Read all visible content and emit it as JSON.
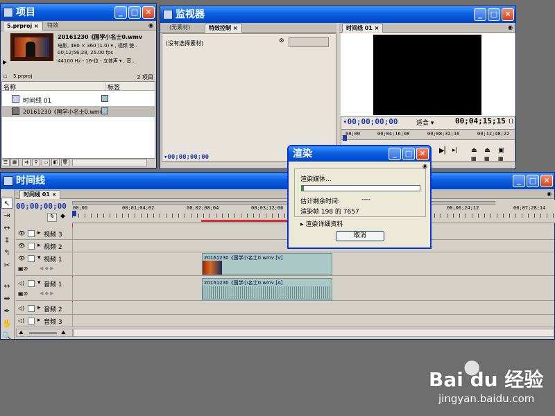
{
  "project": {
    "title": "项目",
    "tabs": [
      "5.prproj",
      "特效"
    ],
    "clip_name": "20161230《国学小名士0.wmv",
    "clip_info1": "电影, 480 × 360 (1.0) ▾ , 视频 使..",
    "clip_info2": "00;12;56;28, 25.00 fps",
    "clip_info3": "44100 Hz - 16-位 - 立体声 ▾ , 音...",
    "bin_name": "5.prproj",
    "item_count": "2 项目",
    "col_name": "名称",
    "col_label": "标签",
    "items": [
      {
        "name": "时间线 01"
      },
      {
        "name": "20161230《国学小名士0.wmv"
      }
    ]
  },
  "monitor": {
    "title": "监视器",
    "source_tabs": [
      "(无素材)",
      "特效控制 ×"
    ],
    "no_clip": "(没有选择素材)",
    "source_tc": "00;00;00;00",
    "program_tab": "时间线 01",
    "program_tc": "00;00;00;00",
    "fit": "适合",
    "duration_tc": "00;04;15;15",
    "ruler": [
      "00;00",
      "00;04;16;08",
      "00;08;32;16",
      "00;12;48;22"
    ]
  },
  "render": {
    "title": "渲染",
    "status": "渲染媒体...",
    "progress": 0.02,
    "time_label": "估计剩余时间:",
    "time_value": "----",
    "frames": "渲染帧 198 的 7657",
    "details": "渲染详细资料",
    "cancel": "取消"
  },
  "timeline": {
    "title": "时间线",
    "tab": "时间线 01",
    "tc": "00;00;00;00",
    "ruler": [
      "00;00",
      "00;01;04;02",
      "00;02;08;04",
      "00;03;12;06",
      "00;06;24;12",
      "00;07;28;14"
    ],
    "tracks": [
      {
        "name": "视频 3"
      },
      {
        "name": "视频 2"
      },
      {
        "name": "视频 1"
      },
      {
        "name": "音频 1"
      },
      {
        "name": "音频 2"
      },
      {
        "name": "音频 3"
      }
    ],
    "clip_video": "20161230《国学小名士0.wmv [V]",
    "clip_audio": "20161230《国学小名士0.wmv [A]"
  },
  "watermark": {
    "brand": "Bai du 经验",
    "url": "jingyan.baidu.com"
  }
}
